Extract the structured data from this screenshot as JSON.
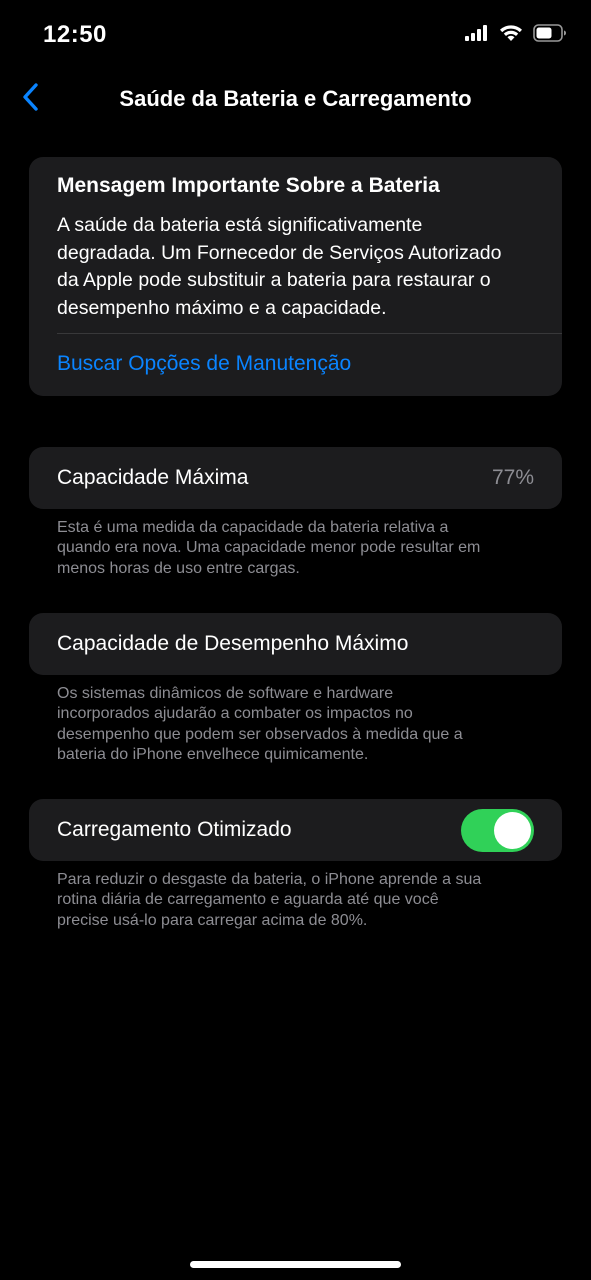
{
  "status_bar": {
    "time": "12:50",
    "icons": [
      "cellular-signal-icon",
      "wifi-icon",
      "battery-icon"
    ]
  },
  "nav": {
    "back_icon": "chevron-left-icon",
    "title": "Saúde da Bateria e Carregamento"
  },
  "message_card": {
    "title": "Mensagem Importante Sobre a Bateria",
    "body_lines": [
      "A saúde da bateria está significativamente",
      "degradada. Um Fornecedor de Serviços Autorizado",
      "da Apple pode substituir a bateria para restaurar o",
      "desempenho máximo e a capacidade."
    ],
    "link": "Buscar Opções de Manutenção"
  },
  "max_capacity": {
    "label": "Capacidade Máxima",
    "value": "77%",
    "footnote_lines": [
      "Esta é uma medida da capacidade da bateria relativa a",
      "quando era nova. Uma capacidade menor pode resultar em",
      "menos horas de uso entre cargas."
    ]
  },
  "peak_performance": {
    "label": "Capacidade de Desempenho Máximo",
    "footnote_lines": [
      "Os sistemas dinâmicos de software e hardware",
      "incorporados ajudarão a combater os impactos no",
      "desempenho que podem ser observados à medida que a",
      "bateria do iPhone envelhece quimicamente."
    ]
  },
  "optimized_charging": {
    "label": "Carregamento Otimizado",
    "enabled": true,
    "footnote_lines": [
      "Para reduzir o desgaste da bateria, o iPhone aprende a sua",
      "rotina diária de carregamento e aguarda até que você",
      "precise usá-lo para carregar acima de 80%."
    ]
  },
  "colors": {
    "background": "#000000",
    "card": "#1c1c1e",
    "accent_link": "#0a84ff",
    "toggle_on": "#30d158",
    "secondary_text": "#8d8d93"
  }
}
